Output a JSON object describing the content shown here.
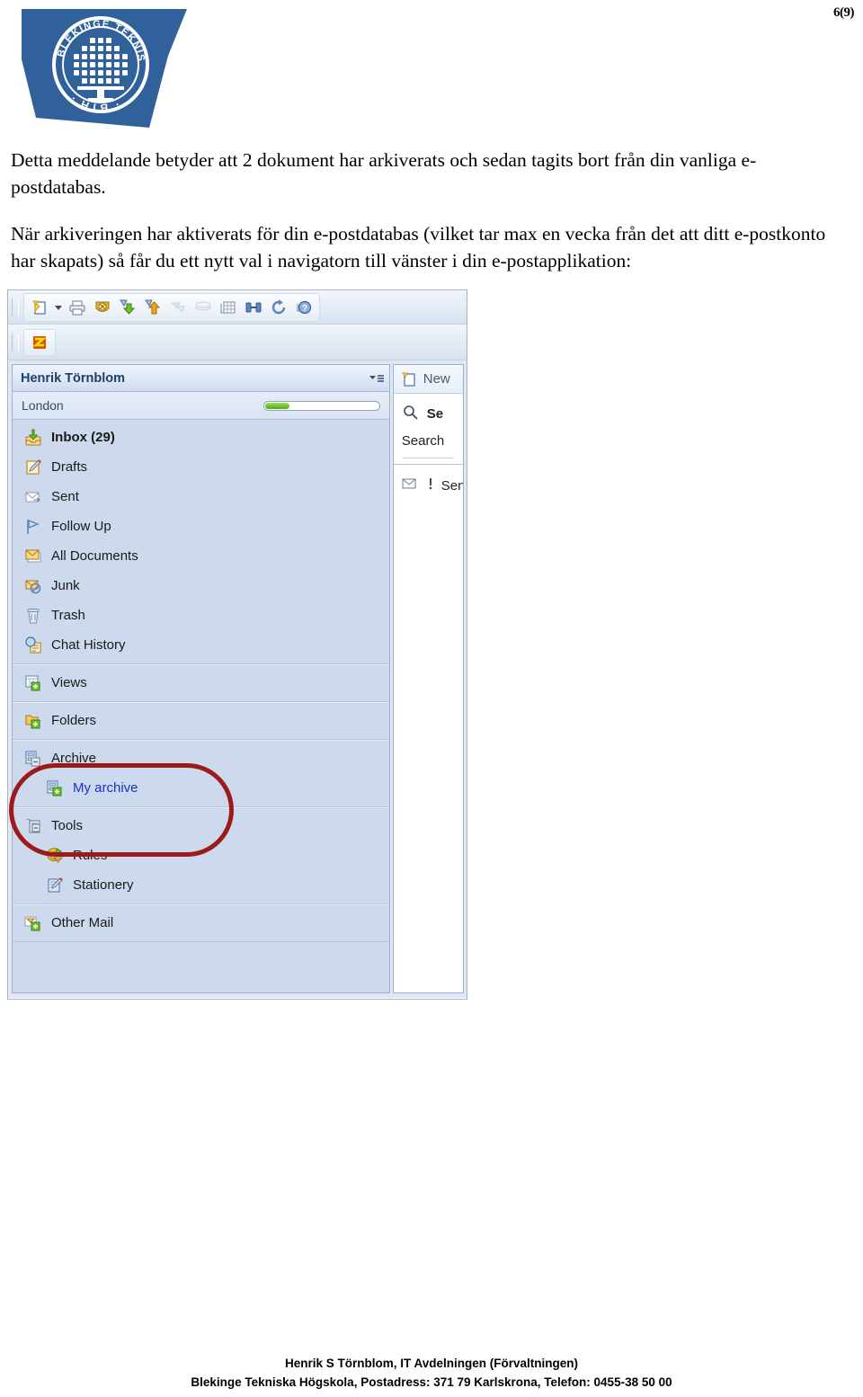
{
  "page": {
    "page_number": "6(9)",
    "logo_alt": "Blekinge Tekniska Högskola BTH",
    "logo_color": "#30619b",
    "logo_ring_text_top": "BLEKINGE TEKNISKA HÖGSKOLA",
    "logo_ring_text_bottom": "· BTH ·"
  },
  "body": {
    "paragraph1": "Detta meddelande betyder att 2 dokument har arkiverats och sedan tagits bort från din vanliga e-postdatabas.",
    "paragraph2": "När arkiveringen har aktiverats för din e-postdatabas (vilket tar max en vecka från det att ditt e-postkonto har skapats) så får du ett nytt val i navigatorn till vänster i din e-postapplikation:"
  },
  "screenshot": {
    "toolbar_primary": [
      {
        "name": "new-document-icon",
        "label": "New Document"
      },
      {
        "name": "chevron-down-icon",
        "label": "More"
      },
      {
        "name": "print-icon",
        "label": "Print"
      },
      {
        "name": "security-shield-icon",
        "label": "Security"
      },
      {
        "name": "download-icon",
        "label": "Receive Mail"
      },
      {
        "name": "upload-icon",
        "label": "Send Mail"
      },
      {
        "name": "indent-icon",
        "label": "Indent"
      },
      {
        "name": "outdent-icon",
        "label": "Outdent"
      },
      {
        "name": "table-icon",
        "label": "Create Table"
      },
      {
        "name": "find-icon",
        "label": "Find"
      },
      {
        "name": "refresh-icon",
        "label": "Refresh"
      },
      {
        "name": "help-icon",
        "label": "Help"
      }
    ],
    "toolbar_secondary": [
      {
        "name": "sametime-icon",
        "label": "Sametime"
      }
    ],
    "navigator": {
      "owner": "Henrik Törnblom",
      "menu_icon": "navigator-menu-icon",
      "quota_label": "London",
      "quota_percent": 22,
      "quota_fill_color": "#6fc22c",
      "sections": [
        {
          "name": "mail-folders",
          "items": [
            {
              "label": "Inbox (29)",
              "icon": "inbox-icon",
              "bold": true,
              "indent": false,
              "link": false
            },
            {
              "label": "Drafts",
              "icon": "drafts-icon",
              "bold": false,
              "indent": false,
              "link": false
            },
            {
              "label": "Sent",
              "icon": "sent-icon",
              "bold": false,
              "indent": false,
              "link": false
            },
            {
              "label": "Follow Up",
              "icon": "flag-icon",
              "bold": false,
              "indent": false,
              "link": false
            },
            {
              "label": "All Documents",
              "icon": "all-documents-icon",
              "bold": false,
              "indent": false,
              "link": false
            },
            {
              "label": "Junk",
              "icon": "junk-icon",
              "bold": false,
              "indent": false,
              "link": false
            },
            {
              "label": "Trash",
              "icon": "trash-icon",
              "bold": false,
              "indent": false,
              "link": false
            },
            {
              "label": "Chat History",
              "icon": "chat-history-icon",
              "bold": false,
              "indent": false,
              "link": false
            }
          ]
        },
        {
          "name": "views",
          "items": [
            {
              "label": "Views",
              "icon": "views-expand-icon",
              "bold": false,
              "indent": false,
              "link": false
            }
          ]
        },
        {
          "name": "folders",
          "items": [
            {
              "label": "Folders",
              "icon": "folders-expand-icon",
              "bold": false,
              "indent": false,
              "link": false
            }
          ]
        },
        {
          "name": "archive",
          "items": [
            {
              "label": "Archive",
              "icon": "archive-collapse-icon",
              "bold": false,
              "indent": false,
              "link": false
            },
            {
              "label": "My archive",
              "icon": "my-archive-icon",
              "bold": false,
              "indent": true,
              "link": true
            }
          ]
        },
        {
          "name": "tools",
          "items": [
            {
              "label": "Tools",
              "icon": "tools-collapse-icon",
              "bold": false,
              "indent": false,
              "link": false
            },
            {
              "label": "Rules",
              "icon": "rules-icon",
              "bold": false,
              "indent": true,
              "link": false
            },
            {
              "label": "Stationery",
              "icon": "stationery-icon",
              "bold": false,
              "indent": true,
              "link": false
            }
          ]
        },
        {
          "name": "other-mail",
          "items": [
            {
              "label": "Other Mail",
              "icon": "other-mail-icon",
              "bold": false,
              "indent": false,
              "link": false
            }
          ]
        }
      ]
    },
    "right_pane": {
      "new_button_label": "New",
      "search_header_label": "Se",
      "search_field_label": "Search",
      "sender_row_label": "Sen"
    },
    "annotation": {
      "name": "archive-highlight-ellipse",
      "color": "#9d1a1a",
      "shape": "rounded-rectangle"
    }
  },
  "footer": {
    "line1": "Henrik S Törnblom, IT Avdelningen (Förvaltningen)",
    "line2": "Blekinge Tekniska Högskola, Postadress: 371 79 Karlskrona, Telefon: 0455-38 50 00"
  }
}
